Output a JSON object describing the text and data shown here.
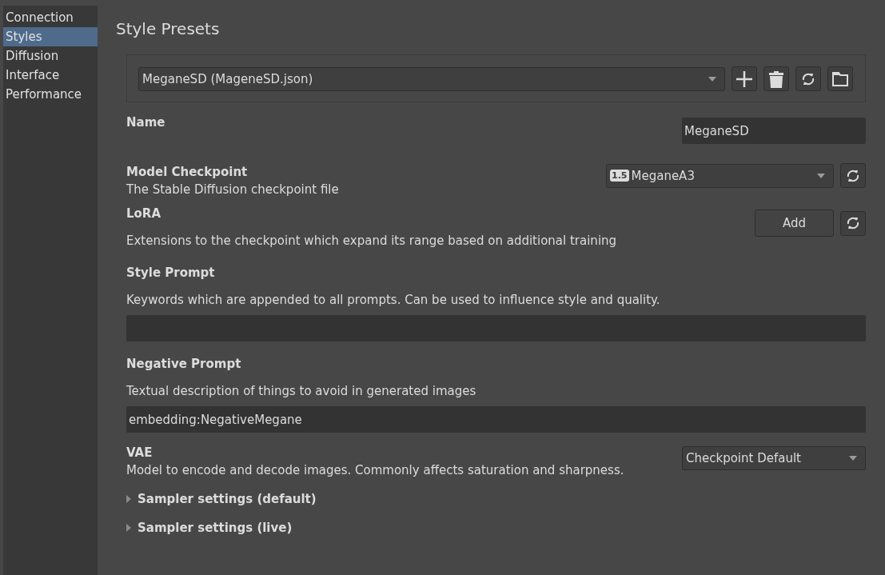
{
  "sidebar": {
    "items": [
      {
        "label": "Connection",
        "selected": false
      },
      {
        "label": "Styles",
        "selected": true
      },
      {
        "label": "Diffusion",
        "selected": false
      },
      {
        "label": "Interface",
        "selected": false
      },
      {
        "label": "Performance",
        "selected": false
      }
    ]
  },
  "title": "Style Presets",
  "preset": {
    "value": "MeganeSD (MageneSD.json)"
  },
  "name": {
    "label": "Name",
    "value": "MeganeSD"
  },
  "checkpoint": {
    "label": "Model Checkpoint",
    "description": "The Stable Diffusion checkpoint file",
    "badge": "1.5",
    "value": "MeganeA3"
  },
  "lora": {
    "label": "LoRA",
    "description": "Extensions to the checkpoint which expand its range based on additional training",
    "button": "Add"
  },
  "style_prompt": {
    "label": "Style Prompt",
    "description": "Keywords which are appended to all prompts. Can be used to influence style and quality."
  },
  "negative_prompt": {
    "label": "Negative Prompt",
    "description": "Textual description of things to avoid in generated images",
    "value": "embedding:NegativeMegane"
  },
  "vae": {
    "label": "VAE",
    "description": "Model to encode and decode images. Commonly affects saturation and sharpness.",
    "value": "Checkpoint Default"
  },
  "sections": [
    {
      "label": "Sampler settings (default)",
      "expanded": false
    },
    {
      "label": "Sampler settings (live)",
      "expanded": false
    }
  ]
}
